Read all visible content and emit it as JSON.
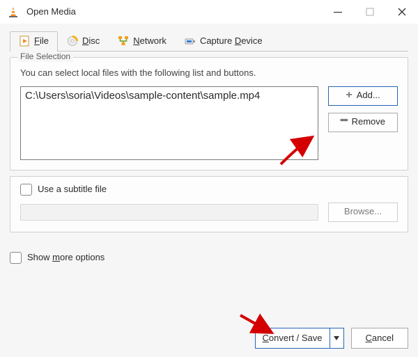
{
  "titlebar": {
    "title": "Open Media"
  },
  "tabs": {
    "file": {
      "pre": "",
      "ul": "F",
      "post": "ile"
    },
    "disc": {
      "pre": "",
      "ul": "D",
      "post": "isc"
    },
    "network": {
      "pre": "",
      "ul": "N",
      "post": "etwork"
    },
    "capture": {
      "pre": "Capture ",
      "ul": "D",
      "post": "evice"
    }
  },
  "file_selection": {
    "legend": "File Selection",
    "help": "You can select local files with the following list and buttons.",
    "files": [
      "C:\\Users\\soria\\Videos\\sample-content\\sample.mp4"
    ],
    "add_label": "Add...",
    "remove_label": "Remove"
  },
  "subtitle": {
    "checkbox_label": "Use a subtitle file",
    "browse_label": "Browse..."
  },
  "bottom": {
    "show_more_pre": "Show ",
    "show_more_ul": "m",
    "show_more_post": "ore options",
    "convert_pre": "",
    "convert_ul": "C",
    "convert_post": "onvert / Save",
    "cancel_pre": "",
    "cancel_ul": "C",
    "cancel_post": "ancel"
  }
}
